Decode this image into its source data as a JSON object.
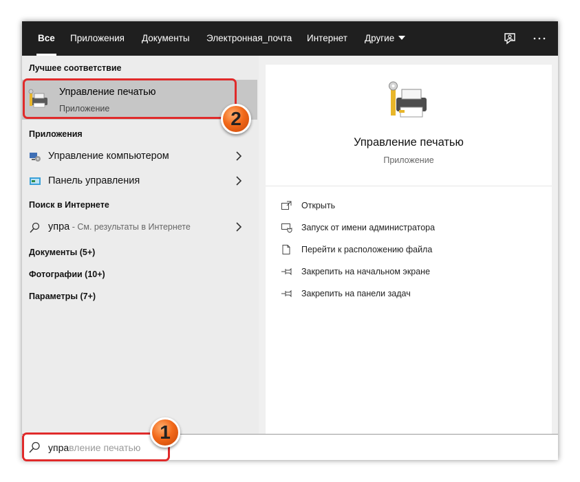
{
  "tabs": [
    {
      "label": "Все"
    },
    {
      "label": "Приложения"
    },
    {
      "label": "Документы"
    },
    {
      "label": "Электронная_почта"
    },
    {
      "label": "Интернет"
    },
    {
      "label": "Другие"
    }
  ],
  "top_icons": [
    "feedback-icon",
    "more-options-icon"
  ],
  "left": {
    "best_match_title": "Лучшее соответствие",
    "best_match": {
      "name": "Управление печатью",
      "type": "Приложение",
      "icon": "print-management-icon"
    },
    "apps_title": "Приложения",
    "apps": [
      {
        "label": "Управление компьютером",
        "icon": "computer-management-icon"
      },
      {
        "label": "Панель управления",
        "icon": "control-panel-icon"
      }
    ],
    "web_title": "Поиск в Интернете",
    "web_result": {
      "query": "упра",
      "hint": "См. результаты в Интернете",
      "separator": " - "
    },
    "documents": "Документы (5+)",
    "photos": "Фотографии (10+)",
    "settings": "Параметры (7+)"
  },
  "preview": {
    "title": "Управление печатью",
    "subtitle": "Приложение",
    "actions": [
      {
        "label": "Открыть",
        "icon": "open-icon"
      },
      {
        "label": "Запуск от имени администратора",
        "icon": "run-as-admin-icon"
      },
      {
        "label": "Перейти к расположению файла",
        "icon": "file-location-icon"
      },
      {
        "label": "Закрепить на начальном экране",
        "icon": "pin-icon"
      },
      {
        "label": "Закрепить на панели задач",
        "icon": "pin-icon"
      }
    ]
  },
  "search": {
    "typed": "упра",
    "suggestion": "вление печатью"
  },
  "annotations": {
    "step1": "1",
    "step2": "2"
  },
  "colors": {
    "tabbar": "#1f1f1f",
    "selected": "#c6c6c6",
    "highlight": "#e02a2a",
    "badge": "#f26a1b"
  }
}
